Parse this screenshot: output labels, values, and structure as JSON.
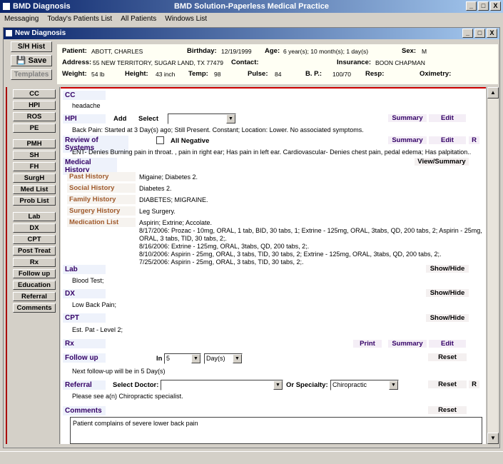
{
  "window": {
    "app_title": "BMD Diagnosis",
    "center_title": "BMD Solution-Paperless Medical Practice",
    "min": "_",
    "max": "□",
    "close": "X"
  },
  "menu": [
    "Messaging",
    "Today's Patients List",
    "All Patients",
    "Windows List"
  ],
  "child": {
    "title": "New Diagnosis"
  },
  "toolbar": {
    "sh_hist": "S/H Hist",
    "save": "Save",
    "templates": "Templates"
  },
  "patient": {
    "patient_label": "Patient:",
    "patient": "ABOTT, CHARLES",
    "birthday_label": "Birthday:",
    "birthday": "12/19/1999",
    "age_label": "Age:",
    "age": "6 year(s); 10 month(s); 1 day(s)",
    "sex_label": "Sex:",
    "sex": "M",
    "address_label": "Address:",
    "address": "55 NEW TERRITORY, SUGAR LAND, TX 77479",
    "contact_label": "Contact:",
    "contact": "",
    "insurance_label": "Insurance:",
    "insurance": "BOON CHAPMAN",
    "weight_label": "Weight:",
    "weight": "54 lb",
    "height_label": "Height:",
    "height": "43 inch",
    "temp_label": "Temp:",
    "temp": "98",
    "pulse_label": "Pulse:",
    "pulse": "84",
    "bp_label": "B. P.:",
    "bp": "100/70",
    "resp_label": "Resp:",
    "resp": "",
    "oximetry_label": "Oximetry:",
    "oximetry": ""
  },
  "nav": [
    "CC",
    "HPI",
    "ROS",
    "PE",
    "PMH",
    "SH",
    "FH",
    "SurgH",
    "Med List",
    "Prob List",
    "Lab",
    "DX",
    "CPT",
    "Post Treat",
    "Rx",
    "Follow up",
    "Education",
    "Referral",
    "Comments"
  ],
  "cc": {
    "label": "CC",
    "text": "headache"
  },
  "hpi": {
    "label": "HPI",
    "add": "Add",
    "select": "Select",
    "summary": "Summary",
    "edit": "Edit",
    "text": "Back Pain: Started at 3 Day(s) ago; Still Present. Constant; Location: Lower. No associated symptoms."
  },
  "ros": {
    "label": "Review of Systems",
    "all_negative": "All Negative",
    "summary": "Summary",
    "edit": "Edit",
    "r": "R",
    "text": "ENT- Denies Burning pain in throat. , pain in right ear; Has pain in left ear. Cardiovascular- Denies chest pain, pedal edema; Has palpitation.."
  },
  "medhist": {
    "label": "Medical History",
    "view_summary": "View/Summary",
    "past_label": "Past History",
    "past": "Migaine; Diabetes 2.",
    "social_label": "Social History",
    "social": "Diabetes 2.",
    "family_label": "Family History",
    "family": "DIABETES; MIGRAINE.",
    "surgery_label": "Surgery History",
    "surgery": "Leg Surgery.",
    "med_label": "Medication List",
    "med_lines": [
      "Aspirin; Extrine; Accolate.",
      "8/17/2006: Prozac - 10mg, ORAL, 1 tab, BID, 30 tabs, 1; Extrine - 125mg, ORAL, 3tabs, QD, 200 tabs, 2; Aspirin - 25mg,",
      "ORAL, 3 tabs, TID, 30 tabs, 2;.",
      "8/16/2006: Extrine - 125mg, ORAL, 3tabs, QD, 200 tabs, 2;.",
      "8/10/2006: Aspirin - 25mg, ORAL, 3 tabs, TID, 30 tabs, 2; Extrine - 125mg, ORAL, 3tabs, QD, 200 tabs, 2;.",
      "7/25/2006: Aspirin - 25mg, ORAL, 3 tabs, TID, 30 tabs, 2;."
    ]
  },
  "lab": {
    "label": "Lab",
    "show_hide": "Show/Hide",
    "text": "Blood Test;"
  },
  "dx": {
    "label": "DX",
    "show_hide": "Show/Hide",
    "text": "Low Back Pain;"
  },
  "cpt": {
    "label": "CPT",
    "show_hide": "Show/Hide",
    "text": "Est. Pat - Level 2;"
  },
  "rx": {
    "label": "Rx",
    "print": "Print",
    "summary": "Summary",
    "edit": "Edit"
  },
  "followup": {
    "label": "Follow up",
    "in": "In",
    "num": "5",
    "unit": "Day(s)",
    "reset": "Reset",
    "text": "Next follow-up will be in 5 Day(s)"
  },
  "referral": {
    "label": "Referral",
    "select_doctor": "Select Doctor:",
    "doctor": "",
    "or_specialty": "Or Specialty:",
    "specialty": "Chiropractic",
    "reset": "Reset",
    "r": "R",
    "text": "Please see a(n) Chiropractic specialist."
  },
  "comments": {
    "label": "Comments",
    "reset": "Reset",
    "text": "Patient complains of severe lower back pain"
  }
}
